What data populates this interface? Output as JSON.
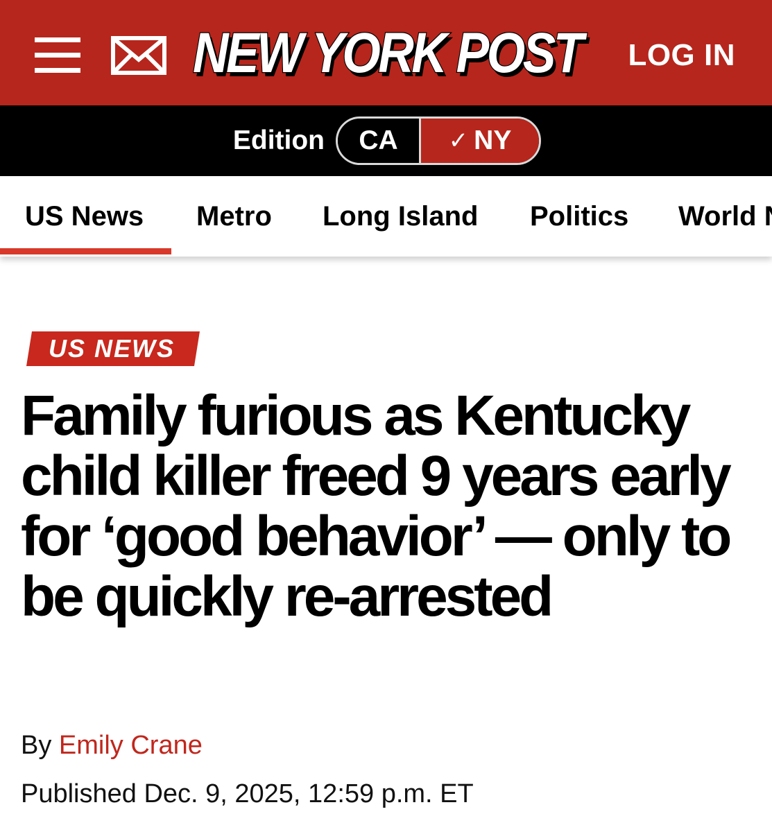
{
  "header": {
    "menu_icon": "hamburger-menu-icon",
    "mail_icon": "envelope-icon",
    "logo_text": "NEW YORK POST",
    "login_label": "LOG IN",
    "brand_color": "#b6261c"
  },
  "edition": {
    "label": "Edition",
    "options": [
      "CA",
      "NY"
    ],
    "selected": "NY",
    "check_icon": "✓"
  },
  "nav": {
    "items": [
      "US News",
      "Metro",
      "Long Island",
      "Politics",
      "World News"
    ],
    "active": "US News",
    "accent_color": "#d8392b"
  },
  "article": {
    "section_tag": "US NEWS",
    "headline": "Family furious as Kentucky child killer freed 9 years early for ‘good behavior’ — only to be quickly re-arrested",
    "byline_prefix": "By",
    "author": "Emily Crane",
    "published": "Published Dec. 9, 2025, 12:59 p.m. ET"
  }
}
